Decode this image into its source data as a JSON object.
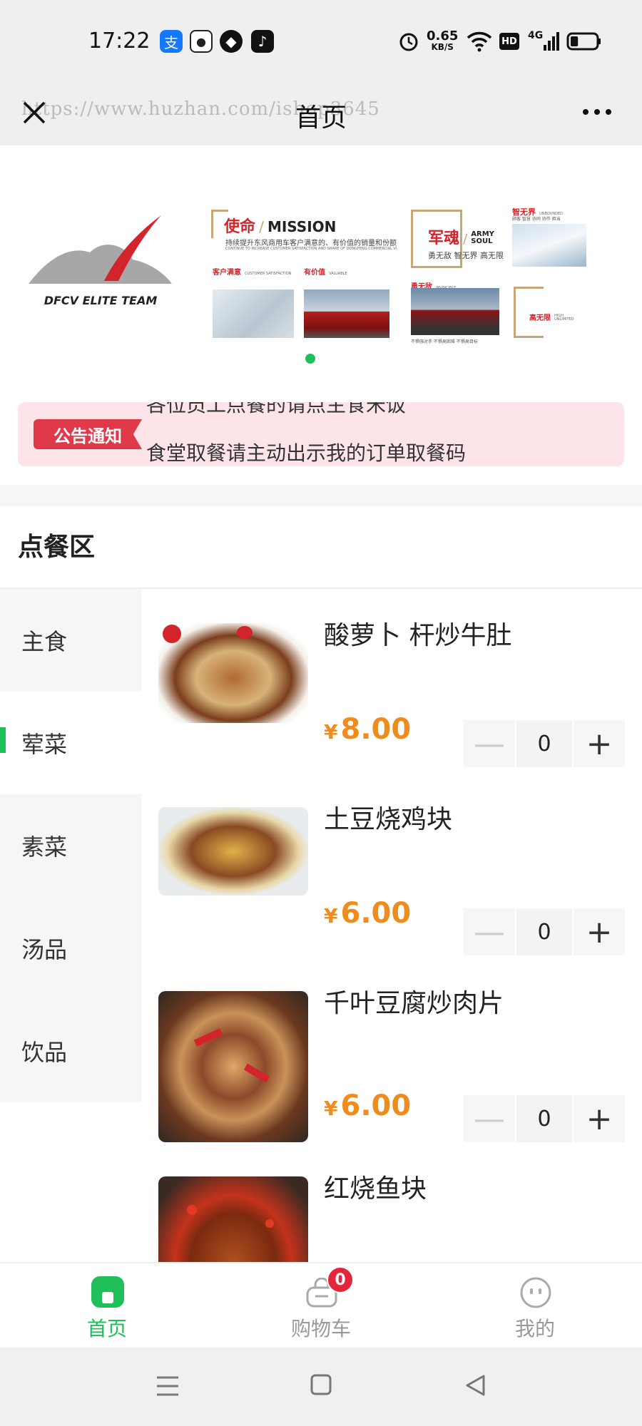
{
  "status_bar": {
    "time": "17:22",
    "net_speed_value": "0.65",
    "net_speed_unit": "KB/S",
    "hd": "HD",
    "network": "4G",
    "battery_level": 0.3
  },
  "navbar": {
    "title": "首页",
    "watermark": "https://www.huzhan.com/ishop3645"
  },
  "banner": {
    "logo_text": "DFCV ELITE TEAM",
    "mission_title": "使命",
    "mission_title_en": "MISSION",
    "mission_sub": "持续提升东风商用车客户满意的、有价值的销量和份额",
    "mission_sub_en": "CONTINUE TO INCREASE CUSTOMER SATISFACTION AND SHARE OF DONGFENG COMMERCIAL VEHICLES",
    "customer_satisfaction": "客户满意",
    "customer_satisfaction_en": "CUSTOMER SATISFACTION",
    "valuable": "有价值",
    "valuable_en": "VALUABLE",
    "army_soul": "军魂",
    "army_soul_en": "ARMY SOUL",
    "army_sub": "勇无敌  智无界  高无限",
    "wisdom": "智无界",
    "wisdom_en": "UNBOUNDED",
    "wisdom_sub": "顾客  智慧  协同  协作  担当",
    "brave": "勇无敌",
    "brave_en": "INVINCIBLE",
    "brave_sub": "不惧强对手  不惧高困难  不惧高目标",
    "high": "高无限",
    "high_en": "HIGH UNLIMITED",
    "active_slide": 1
  },
  "notice": {
    "tag": "公告通知",
    "line1": "各位员工点餐的请点主食米饭",
    "line2": "食堂取餐请主动出示我的订单取餐码"
  },
  "section": {
    "title": "点餐区"
  },
  "categories": [
    {
      "label": "主食"
    },
    {
      "label": "荤菜"
    },
    {
      "label": "素菜"
    },
    {
      "label": "汤品"
    },
    {
      "label": "饮品"
    }
  ],
  "active_category": "荤菜",
  "items": [
    {
      "name": "酸萝卜 杆炒牛肚",
      "currency": "¥",
      "price": "8.00",
      "qty": "0"
    },
    {
      "name": "土豆烧鸡块",
      "currency": "¥",
      "price": "6.00",
      "qty": "0"
    },
    {
      "name": "千叶豆腐炒肉片",
      "currency": "¥",
      "price": "6.00",
      "qty": "0"
    },
    {
      "name": "红烧鱼块",
      "currency": "¥",
      "price": "",
      "qty": ""
    }
  ],
  "stepper": {
    "minus": "—",
    "plus": "+"
  },
  "tabbar": {
    "home": "首页",
    "cart": "购物车",
    "cart_badge": "0",
    "mine": "我的"
  },
  "colors": {
    "accent": "#1fbf5a",
    "price": "#f08c1c",
    "notice_bg": "#fde4e8",
    "notice_tag": "#e0394a",
    "badge": "#e4263a"
  },
  "icons": [
    "close-icon",
    "more-icon",
    "alarm-icon",
    "wifi-icon",
    "signal-icon",
    "battery-icon",
    "home-icon",
    "cart-icon",
    "mine-icon",
    "menu-nav-icon",
    "home-nav-icon",
    "back-nav-icon"
  ]
}
